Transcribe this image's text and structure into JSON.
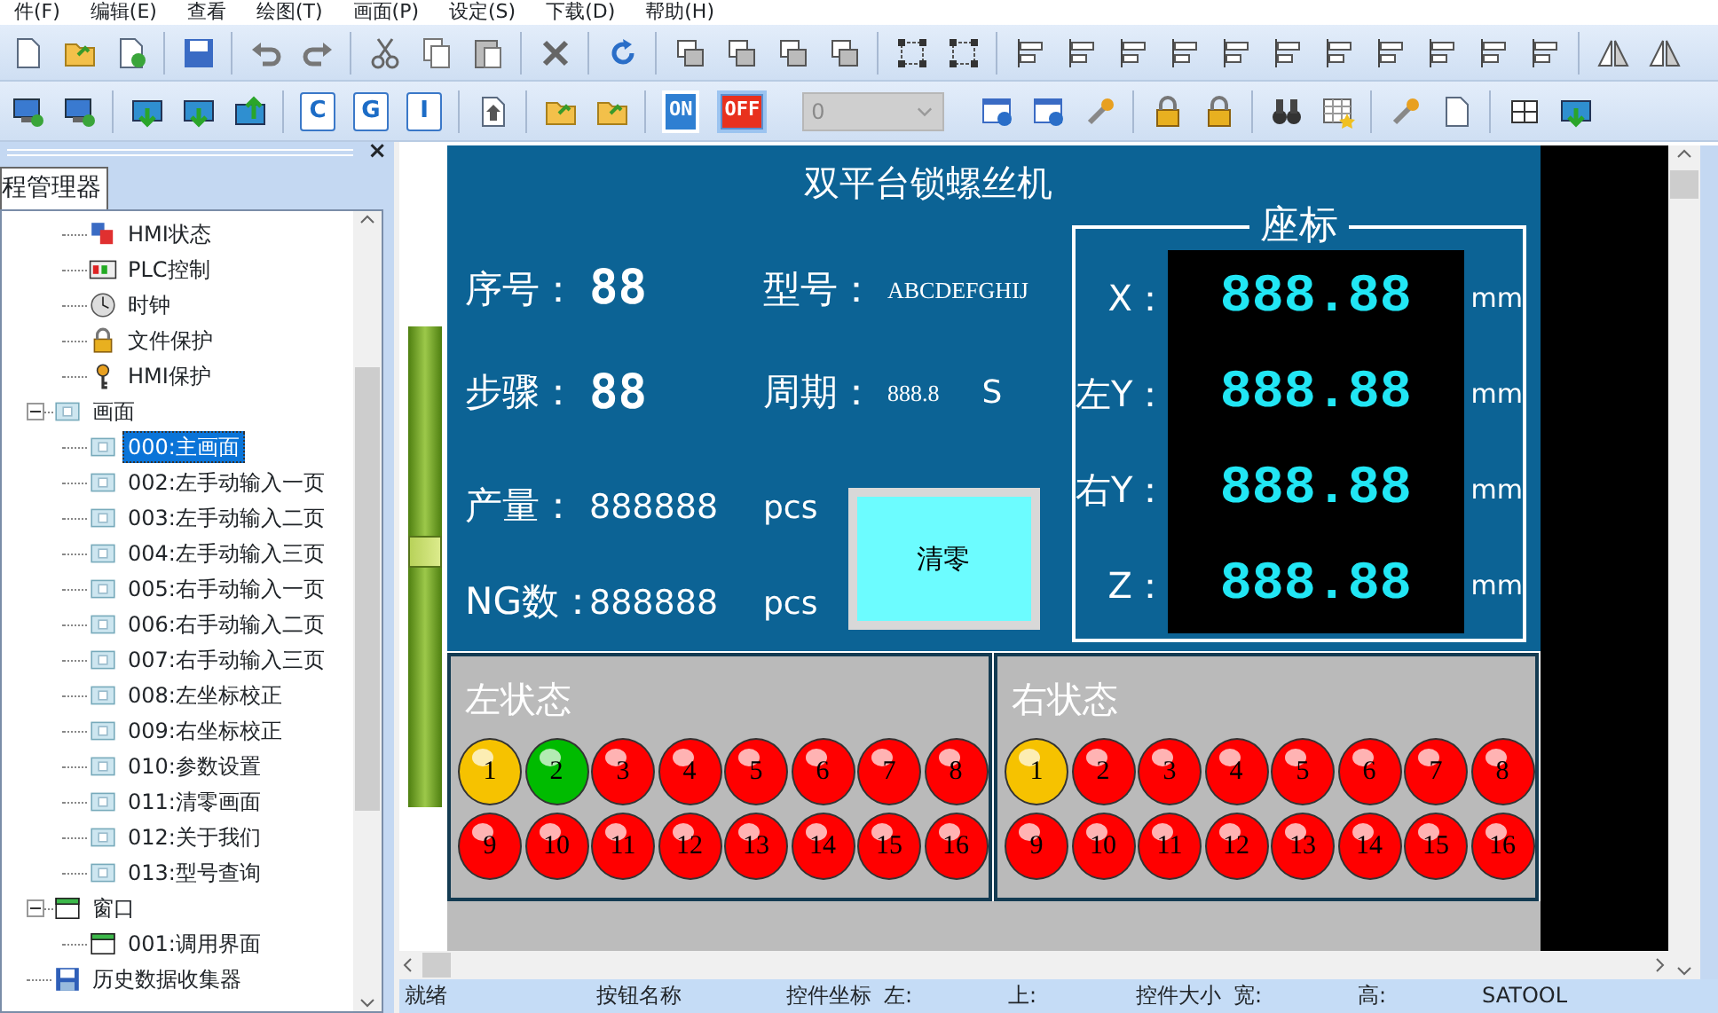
{
  "menu": [
    "件(F)",
    "编辑(E)",
    "查看",
    "绘图(T)",
    "画面(P)",
    "设定(S)",
    "下载(D)",
    "帮助(H)"
  ],
  "toolbar_2": {
    "letter_buttons": [
      "C",
      "G",
      "I"
    ],
    "switches": [
      {
        "label": "ON",
        "pressed": false,
        "color": "#2e7fd2"
      },
      {
        "label": "OFF",
        "pressed": true,
        "color": "#e8311e"
      }
    ],
    "combo": {
      "value": "0",
      "disabled": true
    }
  },
  "project_panel": {
    "close": "×",
    "tab": "程管理器",
    "tree": [
      {
        "children": [
          {
            "label": "HMI状态",
            "kind": "status",
            "selected": false
          },
          {
            "label": "PLC控制",
            "kind": "plc",
            "selected": false
          },
          {
            "label": "时钟",
            "kind": "clock",
            "selected": false
          },
          {
            "label": "文件保护",
            "kind": "lock",
            "selected": false
          },
          {
            "label": "HMI保护",
            "kind": "key",
            "selected": false
          }
        ]
      },
      {
        "label": "画面",
        "kind": "screen",
        "selected": false,
        "expanded": true,
        "children": [
          {
            "label": "000:主画面",
            "kind": "screen",
            "selected": true
          },
          {
            "label": "002:左手动输入一页",
            "kind": "screen",
            "selected": false
          },
          {
            "label": "003:左手动输入二页",
            "kind": "screen",
            "selected": false
          },
          {
            "label": "004:左手动输入三页",
            "kind": "screen",
            "selected": false
          },
          {
            "label": "005:右手动输入一页",
            "kind": "screen",
            "selected": false
          },
          {
            "label": "006:右手动输入二页",
            "kind": "screen",
            "selected": false
          },
          {
            "label": "007:右手动输入三页",
            "kind": "screen",
            "selected": false
          },
          {
            "label": "008:左坐标校正",
            "kind": "screen",
            "selected": false
          },
          {
            "label": "009:右坐标校正",
            "kind": "screen",
            "selected": false
          },
          {
            "label": "010:参数设置",
            "kind": "screen",
            "selected": false
          },
          {
            "label": "011:清零画面",
            "kind": "screen",
            "selected": false
          },
          {
            "label": "012:关于我们",
            "kind": "screen",
            "selected": false
          },
          {
            "label": "013:型号查询",
            "kind": "screen",
            "selected": false
          }
        ]
      },
      {
        "label": "窗口",
        "kind": "window",
        "selected": false,
        "expanded": true,
        "children": [
          {
            "label": "001:调用界面",
            "kind": "window",
            "selected": false
          }
        ]
      },
      {
        "label": "历史数据收集器",
        "kind": "collector",
        "selected": false
      }
    ]
  },
  "canvas_slider": {
    "level": 0.53
  },
  "hmi": {
    "title": "双平台锁螺丝机",
    "info_rows": [
      [
        {
          "label": "序号：",
          "value": "88",
          "kind": "digital"
        },
        {
          "label": "型号：",
          "value": "ABCDEFGHIJ",
          "kind": "plain"
        }
      ],
      [
        {
          "label": "步骤：",
          "value": "88",
          "kind": "digital"
        },
        {
          "label": "周期：",
          "value": "888.8",
          "kind": "plain",
          "unit": "S"
        }
      ]
    ],
    "counters": [
      {
        "label": "产量：",
        "value": "888888",
        "unit": "pcs"
      },
      {
        "label": "NG数：",
        "value": "888888",
        "unit": "pcs"
      }
    ],
    "reset_button": "清零",
    "coords": {
      "title": "座标",
      "rows": [
        {
          "label": "X：",
          "value": "888.88",
          "unit": "mm"
        },
        {
          "label": "左Y：",
          "value": "888.88",
          "unit": "mm"
        },
        {
          "label": "右Y：",
          "value": "888.88",
          "unit": "mm"
        },
        {
          "label": "Z：",
          "value": "888.88",
          "unit": "mm"
        }
      ]
    },
    "status_panels": [
      {
        "title": "左状态",
        "lamps": [
          {
            "number": "1",
            "color": "#f6c200"
          },
          {
            "number": "2",
            "color": "#00bb00"
          },
          {
            "number": "3",
            "color": "#ff0000"
          },
          {
            "number": "4",
            "color": "#ff0000"
          },
          {
            "number": "5",
            "color": "#ff0000"
          },
          {
            "number": "6",
            "color": "#ff0000"
          },
          {
            "number": "7",
            "color": "#ff0000"
          },
          {
            "number": "8",
            "color": "#ff0000"
          },
          {
            "number": "9",
            "color": "#ff0000"
          },
          {
            "number": "10",
            "color": "#ff0000"
          },
          {
            "number": "11",
            "color": "#ff0000"
          },
          {
            "number": "12",
            "color": "#ff0000"
          },
          {
            "number": "13",
            "color": "#ff0000"
          },
          {
            "number": "14",
            "color": "#ff0000"
          },
          {
            "number": "15",
            "color": "#ff0000"
          },
          {
            "number": "16",
            "color": "#ff0000"
          }
        ]
      },
      {
        "title": "右状态",
        "lamps": [
          {
            "number": "1",
            "color": "#f6c200"
          },
          {
            "number": "2",
            "color": "#ff0000"
          },
          {
            "number": "3",
            "color": "#ff0000"
          },
          {
            "number": "4",
            "color": "#ff0000"
          },
          {
            "number": "5",
            "color": "#ff0000"
          },
          {
            "number": "6",
            "color": "#ff0000"
          },
          {
            "number": "7",
            "color": "#ff0000"
          },
          {
            "number": "8",
            "color": "#ff0000"
          },
          {
            "number": "9",
            "color": "#ff0000"
          },
          {
            "number": "10",
            "color": "#ff0000"
          },
          {
            "number": "11",
            "color": "#ff0000"
          },
          {
            "number": "12",
            "color": "#ff0000"
          },
          {
            "number": "13",
            "color": "#ff0000"
          },
          {
            "number": "14",
            "color": "#ff0000"
          },
          {
            "number": "15",
            "color": "#ff0000"
          },
          {
            "number": "16",
            "color": "#ff0000"
          }
        ]
      }
    ]
  },
  "status_bar": [
    "就绪",
    "按钮名称",
    "控件坐标",
    "左:",
    "上:",
    "控件大小",
    "宽:",
    "高:",
    "SATOOL"
  ]
}
